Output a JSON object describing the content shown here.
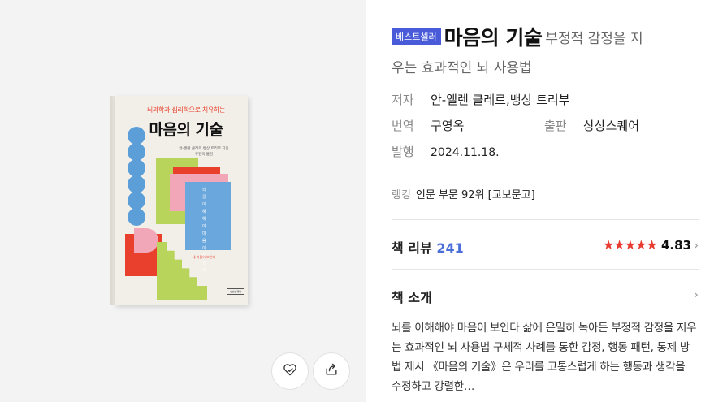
{
  "cover": {
    "subtitle": "뇌과학과 심리학으로 치유하는",
    "title": "마음의 기술",
    "authors_line1": "안-엘렌 클레르 뱅상 트리부 지음",
    "authors_line2": "구영옥 옮김",
    "vertical_text": "뇌를 이해해야 마음이 보인다",
    "tagline": "내 마음이 보인다",
    "publisher_mark": "상상스퀘어"
  },
  "book": {
    "badge": "베스트셀러",
    "title": "마음의 기술",
    "subtitle_part1": "부정적 감정을 지",
    "subtitle_part2": "우는 효과적인 뇌 사용법",
    "author_label": "저자",
    "author": "안-엘렌 클레르,뱅상 트리부",
    "translator_label": "번역",
    "translator": "구영옥",
    "publisher_label": "출판",
    "publisher": "상상스퀘어",
    "date_label": "발행",
    "date": "2024.11.18.",
    "ranking_label": "랭킹",
    "ranking": "인문 부문 92위 [교보문고]"
  },
  "review": {
    "label": "책 리뷰",
    "count": "241",
    "stars": "★★★★★",
    "score": "4.83",
    "chevron": "›"
  },
  "intro": {
    "label": "책 소개",
    "chevron": "›",
    "text": "뇌를 이해해야 마음이 보인다 삶에 은밀히 녹아든 부정적 감정을 지우는 효과적인 뇌 사용법 구체적 사례를 통한 감정, 행동 패턴, 통제 방법 제시 《마음의 기술》은 우리를 고통스럽게 하는 행동과 생각을 수정하고 강렬한…"
  },
  "icons": {
    "like": "heart-check-icon",
    "share": "share-icon"
  },
  "colors": {
    "badge": "#4a5bd9",
    "stars": "#e83a2e",
    "review_count": "#4a6fd8",
    "cover_blue": "#5b9ed8",
    "cover_red": "#e8402d",
    "cover_green": "#b9d45a",
    "cover_pink": "#f2a7b8"
  }
}
